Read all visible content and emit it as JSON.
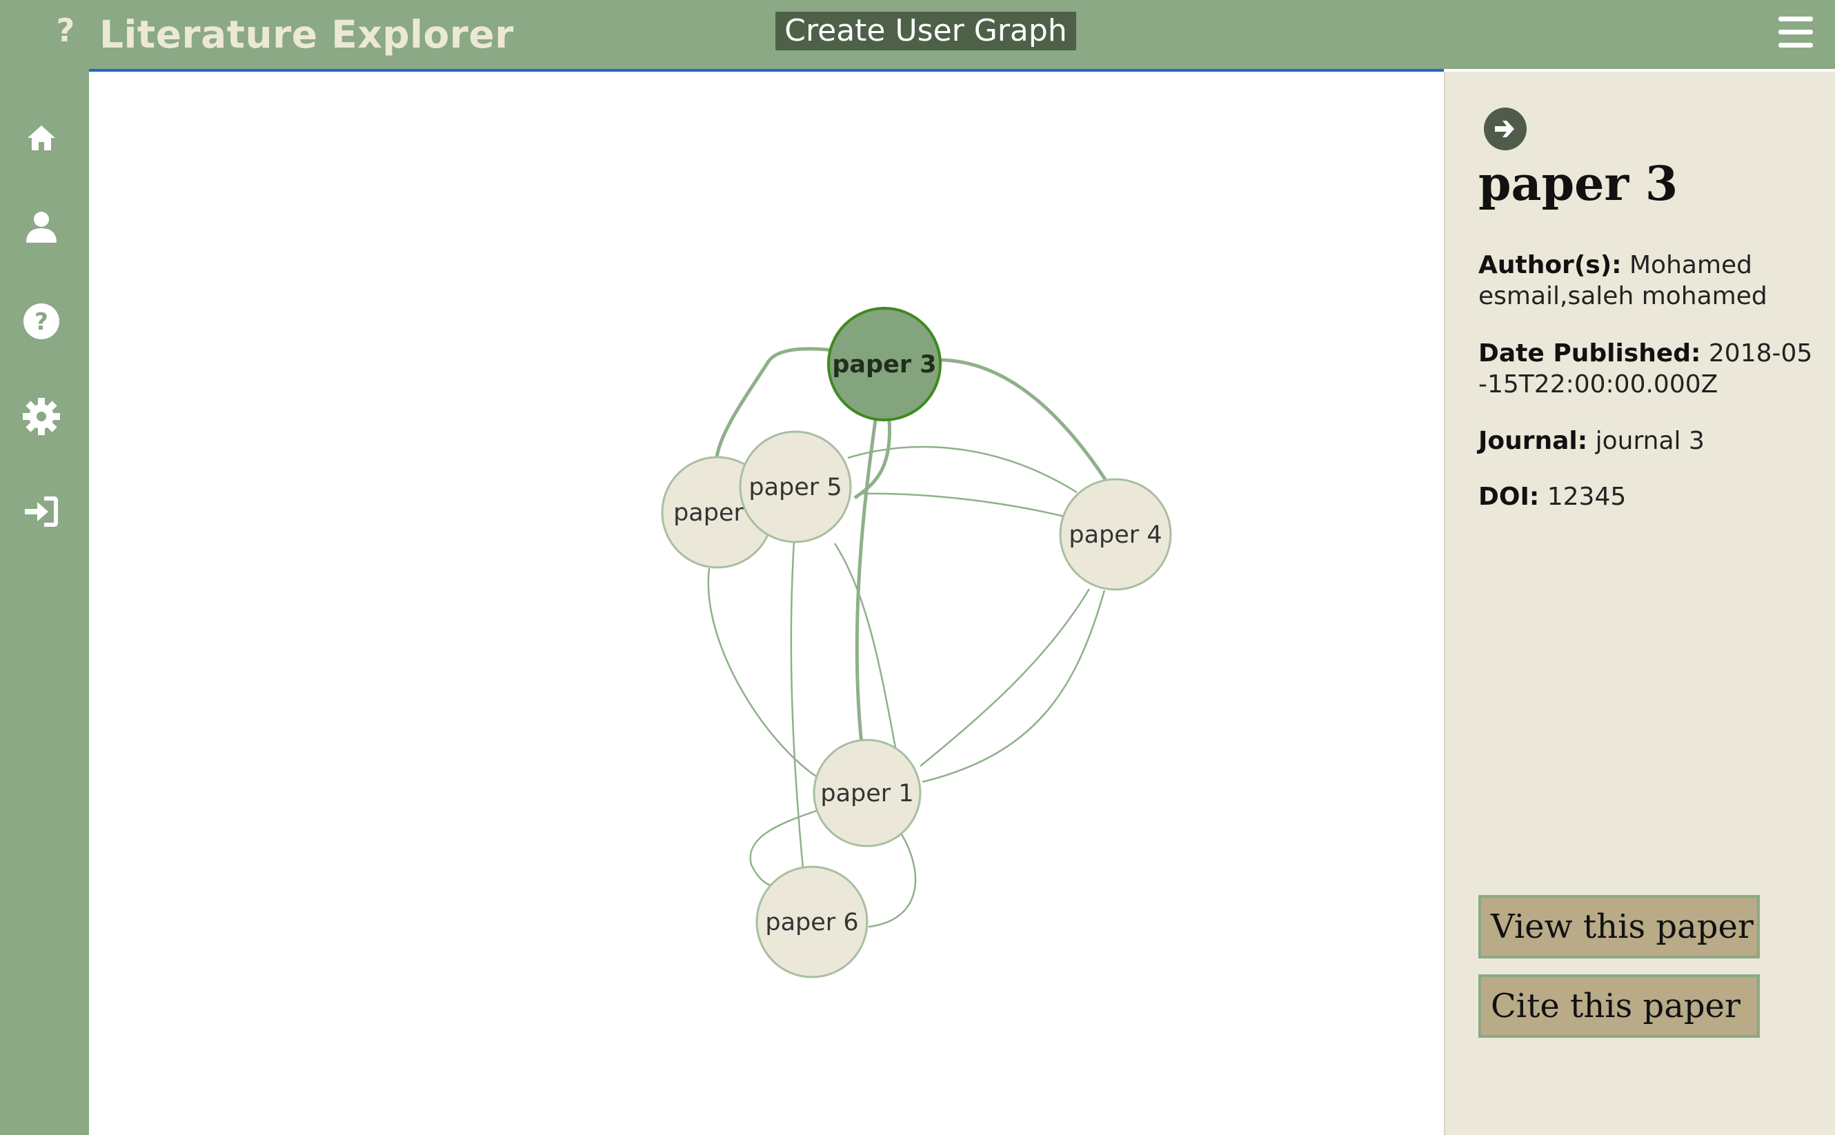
{
  "header": {
    "help_glyph": "?",
    "title": "Literature Explorer",
    "create_button": "Create User Graph"
  },
  "nav": {
    "items": [
      {
        "name": "home-icon"
      },
      {
        "name": "user-icon"
      },
      {
        "name": "help-icon"
      },
      {
        "name": "settings-icon"
      },
      {
        "name": "login-icon"
      }
    ]
  },
  "graph": {
    "nodes": [
      {
        "id": "paper-3",
        "label": "paper 3",
        "selected": true
      },
      {
        "id": "paper-5",
        "label": "paper 5",
        "selected": false
      },
      {
        "id": "paper-2",
        "label": "paper",
        "selected": false
      },
      {
        "id": "paper-4",
        "label": "paper 4",
        "selected": false
      },
      {
        "id": "paper-1",
        "label": "paper 1",
        "selected": false
      },
      {
        "id": "paper-6",
        "label": "paper 6",
        "selected": false
      }
    ]
  },
  "panel": {
    "title": "paper 3",
    "authors_label": "Author(s):",
    "authors_value": "Mohamed esmail,saleh mohamed",
    "date_label": "Date Published:",
    "date_value": "2018-05-15T22:00:00.000Z",
    "journal_label": "Journal:",
    "journal_value": "journal 3",
    "doi_label": "DOI:",
    "doi_value": "12345",
    "view_button": "View this paper",
    "cite_button": "Cite this paper"
  },
  "colors": {
    "header_bg": "#8aa984",
    "node_fill": "#ebe8d9",
    "node_selected_fill": "#84a47e",
    "edge": "#8fb08a",
    "panel_bg": "#ebe8d9",
    "button_bg": "#b9aa88"
  }
}
